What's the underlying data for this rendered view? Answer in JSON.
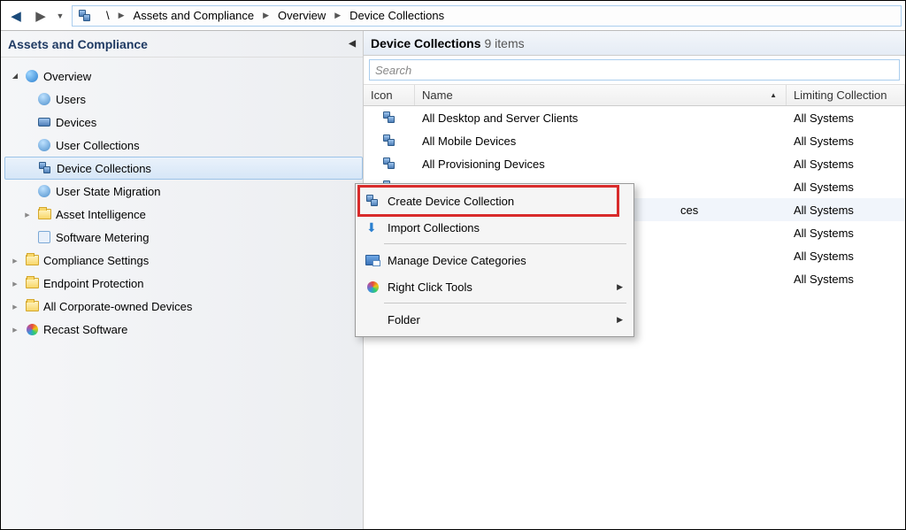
{
  "breadcrumb": {
    "root_icon": "root-icon",
    "segments": [
      "\\",
      "Assets and Compliance",
      "Overview",
      "Device Collections"
    ]
  },
  "sidebar": {
    "title": "Assets and Compliance",
    "nodes": [
      {
        "label": "Overview",
        "icon": "globe",
        "expander": "open",
        "indent": 0
      },
      {
        "label": "Users",
        "icon": "user",
        "expander": "",
        "indent": 1
      },
      {
        "label": "Devices",
        "icon": "device",
        "expander": "",
        "indent": 1
      },
      {
        "label": "User Collections",
        "icon": "user-coll",
        "expander": "",
        "indent": 1
      },
      {
        "label": "Device Collections",
        "icon": "coll",
        "expander": "",
        "indent": 1,
        "selected": true
      },
      {
        "label": "User State Migration",
        "icon": "user",
        "expander": "",
        "indent": 1
      },
      {
        "label": "Asset Intelligence",
        "icon": "folder",
        "expander": "closed",
        "indent": 1
      },
      {
        "label": "Software Metering",
        "icon": "meter",
        "expander": "",
        "indent": 1
      },
      {
        "label": "Compliance Settings",
        "icon": "folder",
        "expander": "closed",
        "indent": 0
      },
      {
        "label": "Endpoint Protection",
        "icon": "folder",
        "expander": "closed",
        "indent": 0
      },
      {
        "label": "All Corporate-owned Devices",
        "icon": "folder",
        "expander": "closed",
        "indent": 0
      },
      {
        "label": "Recast Software",
        "icon": "colorball",
        "expander": "closed",
        "indent": 0
      }
    ]
  },
  "content": {
    "title": "Device Collections",
    "count_text": "9 items",
    "search_placeholder": "Search",
    "columns": {
      "icon": "Icon",
      "name": "Name",
      "lim": "Limiting Collection"
    },
    "rows": [
      {
        "name": "All Desktop and Server Clients",
        "lim": "All Systems"
      },
      {
        "name": "All Mobile Devices",
        "lim": "All Systems"
      },
      {
        "name": "All Provisioning Devices",
        "lim": "All Systems"
      },
      {
        "name": "",
        "lim": "All Systems"
      },
      {
        "name_suffix": "ces",
        "lim": "All Systems",
        "hover": true
      },
      {
        "name": "",
        "lim": "All Systems"
      },
      {
        "name": "",
        "lim": "All Systems"
      },
      {
        "name": "",
        "lim": "All Systems"
      }
    ]
  },
  "context_menu": {
    "items": [
      {
        "label": "Create Device Collection",
        "icon": "coll-new",
        "highlight": true
      },
      {
        "label": "Import Collections",
        "icon": "arrow-down"
      },
      {
        "sep": true
      },
      {
        "label": "Manage Device Categories",
        "icon": "cat"
      },
      {
        "label": "Right Click Tools",
        "icon": "colorball",
        "submenu": true
      },
      {
        "sep": true
      },
      {
        "label": "Folder",
        "icon": "",
        "submenu": true
      }
    ]
  }
}
